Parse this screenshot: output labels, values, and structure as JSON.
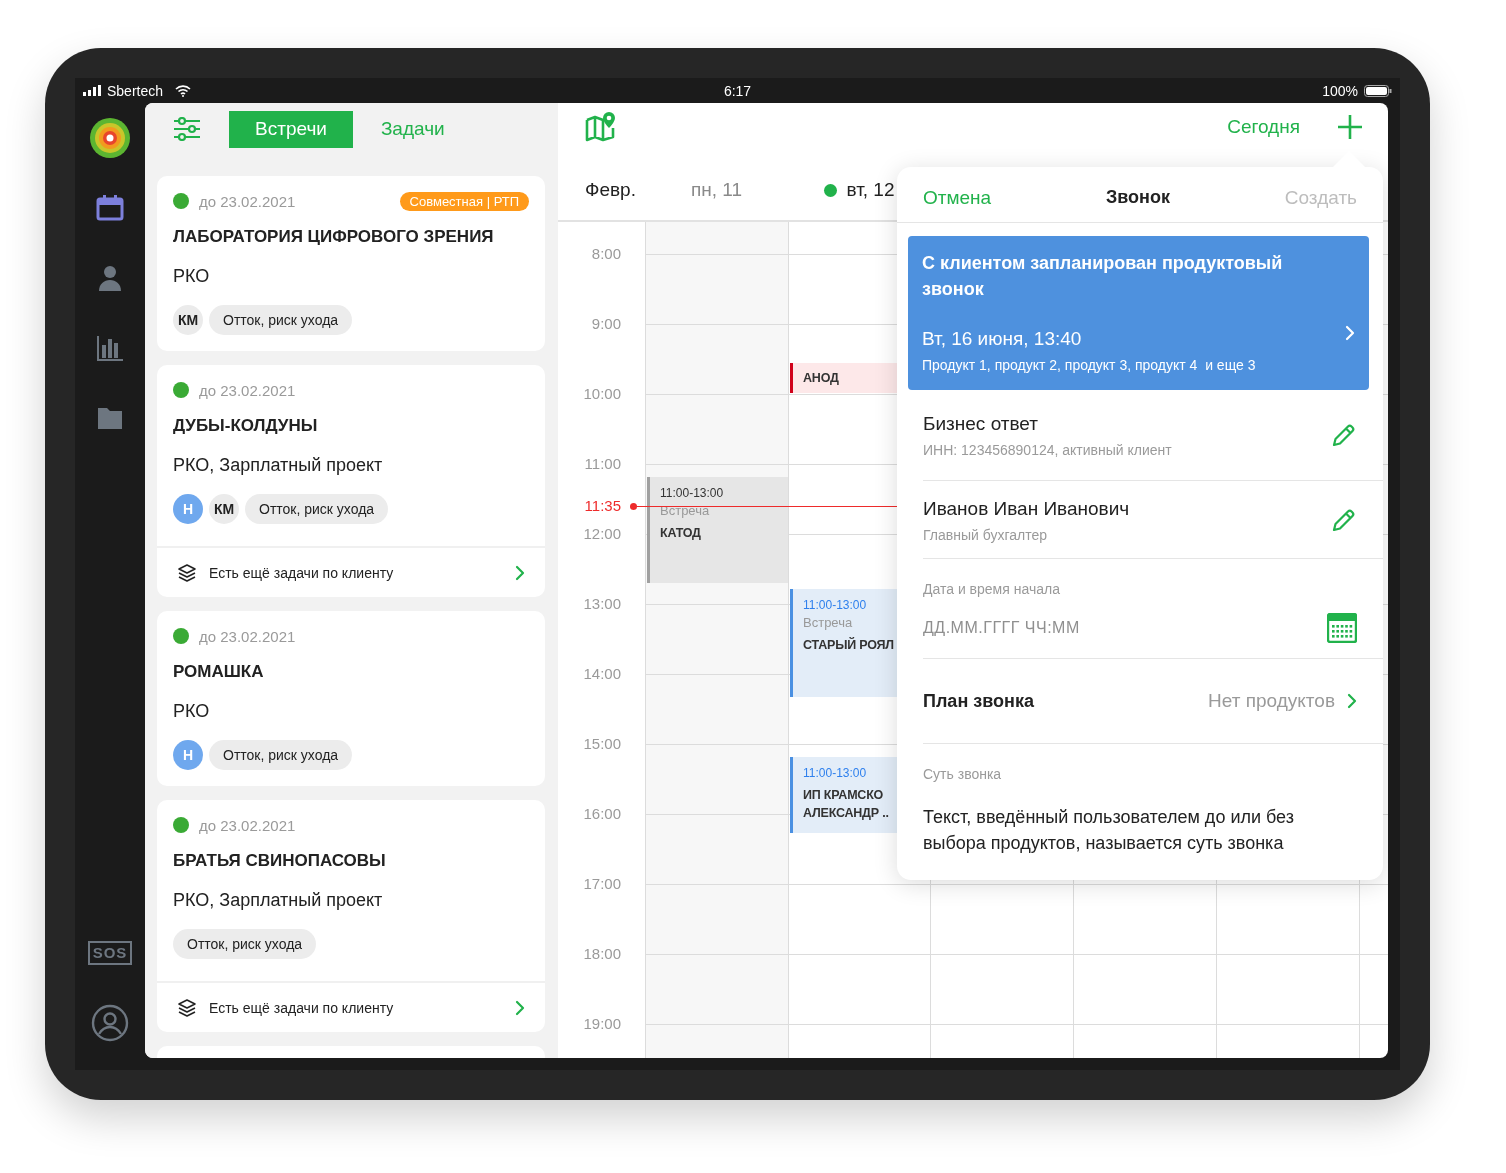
{
  "status_bar": {
    "carrier": "Sbertech",
    "time": "6:17",
    "battery": "100%"
  },
  "sidebar": {
    "items": [
      {
        "kind": "calendar",
        "selected": true
      },
      {
        "kind": "person",
        "selected": false
      },
      {
        "kind": "chart",
        "selected": false
      },
      {
        "kind": "folder",
        "selected": false
      }
    ],
    "sos_label": "SOS"
  },
  "tasks_panel": {
    "tabs": [
      {
        "label": "Встречи",
        "selected": true
      },
      {
        "label": "Задачи",
        "selected": false
      }
    ],
    "cards": [
      {
        "due": "до 23.02.2021",
        "color": "#3aaa35",
        "badge": "Совместная | РТП",
        "title": "ЛАБОРАТОРИЯ ЦИФРОВОГО ЗРЕНИЯ",
        "products": "РКО",
        "tags": [
          {
            "kind": "initials",
            "label": "КМ",
            "color": "#ebebeb"
          },
          {
            "kind": "chip",
            "label": "Отток, риск ухода"
          }
        ]
      },
      {
        "due": "до 23.02.2021",
        "color": "#3aaa35",
        "title": "ДУБЫ-КОЛДУНЫ",
        "products": "РКО, Зарплатный проект",
        "tags": [
          {
            "kind": "initials",
            "label": "Н",
            "color": "#6fa8ee"
          },
          {
            "kind": "initials",
            "label": "КМ",
            "color": "#ebebeb"
          },
          {
            "kind": "chip",
            "label": "Отток, риск ухода"
          }
        ],
        "more_tasks": "Есть ещё задачи по клиенту"
      },
      {
        "due": "до 23.02.2021",
        "color": "#3aaa35",
        "title": "РОМАШКА",
        "products": "РКО",
        "tags": [
          {
            "kind": "initials",
            "label": "Н",
            "color": "#6fa8ee"
          },
          {
            "kind": "chip",
            "label": "Отток, риск ухода"
          }
        ]
      },
      {
        "due": "до 23.02.2021",
        "color": "#3aaa35",
        "title": "БРАТЬЯ СВИНОПАСОВЫ",
        "products": "РКО, Зарплатный проект",
        "tags": [
          {
            "kind": "chip",
            "label": "Отток, риск ухода"
          }
        ],
        "more_tasks": "Есть ещё задачи по клиенту"
      }
    ]
  },
  "calendar": {
    "today_button": "Сегодня",
    "month": "Февр.",
    "hours": [
      "8:00",
      "9:00",
      "10:00",
      "11:00",
      "12:00",
      "13:00",
      "14:00",
      "15:00",
      "16:00",
      "17:00",
      "18:00",
      "19:00"
    ],
    "now": "11:35",
    "days": [
      {
        "label": "пн, 11",
        "today": false,
        "events": [
          {
            "kind": "past",
            "time": "11:00-13:00",
            "type": "Встреча",
            "title": "КАТОД"
          }
        ]
      },
      {
        "label": "вт, 12",
        "today": true,
        "events": [
          {
            "kind": "alert",
            "title": "АНОД"
          },
          {
            "kind": "meeting",
            "time": "11:00-13:00",
            "type": "Встреча",
            "title": "СТАРЫЙ РОЯЛ"
          },
          {
            "kind": "meeting",
            "time": "11:00-13:00",
            "title": "ИП КРАМСКО\nАЛЕКСАНДР .."
          }
        ]
      }
    ]
  },
  "popup": {
    "cancel": "Отмена",
    "title": "Звонок",
    "create": "Создать",
    "create_disabled": true,
    "summary": {
      "title": "С клиентом запланирован продуктовый звонок",
      "when": "Вт, 16 июня, 13:40",
      "products": "Продукт 1, продукт 2, продукт 3, продукт 4  и еще 3"
    },
    "contacts": [
      {
        "name": "Бизнес ответ",
        "detail": "ИНН: 123456890124, активный клиент"
      },
      {
        "name": "Иванов Иван Иванович",
        "detail": "Главный бухгалтер"
      }
    ],
    "start": {
      "label": "Дата и время начала",
      "placeholder": "ДД.ММ.ГГГГ ЧЧ:ММ"
    },
    "plan": {
      "label": "План звонка",
      "value": "Нет продуктов"
    },
    "essence": {
      "label": "Суть звонка",
      "text": "Текст, введённый пользователем до или без выбора продуктов, называется суть звонка"
    }
  }
}
